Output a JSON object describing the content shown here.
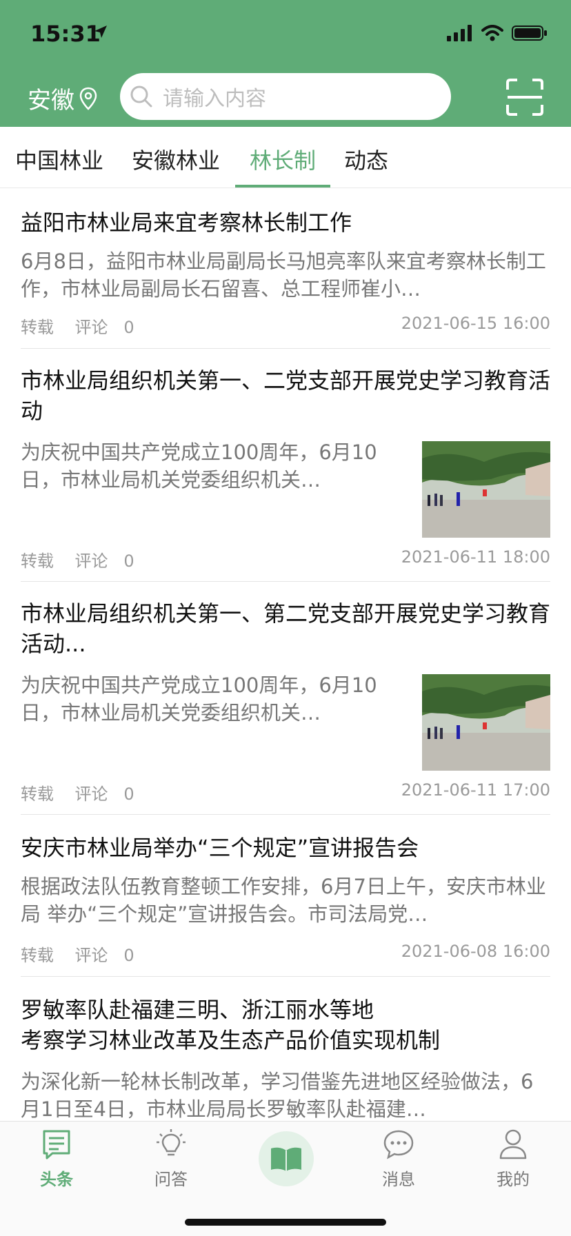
{
  "status_bar": {
    "time": "15:31"
  },
  "header": {
    "location": "安徽",
    "search_placeholder": "请输入内容"
  },
  "tabs": [
    {
      "label": "中国林业",
      "active": false
    },
    {
      "label": "安徽林业",
      "active": false
    },
    {
      "label": "林长制",
      "active": true
    },
    {
      "label": "动态",
      "active": false
    }
  ],
  "articles": [
    {
      "title": "益阳市林业局来宜考察林长制工作",
      "summary": "6月8日，益阳市林业局副局长马旭亮率队来宜考察林长制工作，市林业局副局长石留喜、总工程师崔小…",
      "source": "转载",
      "comment_label": "评论",
      "comments": "0",
      "time": "2021-06-15 16:00",
      "has_image": false
    },
    {
      "title": "市林业局组织机关第一、二党支部开展党史学习教育活动",
      "summary": "为庆祝中国共产党成立100周年，6月10日，市林业局机关党委组织机关…",
      "source": "转载",
      "comment_label": "评论",
      "comments": "0",
      "time": "2021-06-11 18:00",
      "has_image": true
    },
    {
      "title": "市林业局组织机关第一、第二党支部开展党史学习教育活动...",
      "summary": "为庆祝中国共产党成立100周年，6月10日，市林业局机关党委组织机关…",
      "source": "转载",
      "comment_label": "评论",
      "comments": "0",
      "time": "2021-06-11 17:00",
      "has_image": true
    },
    {
      "title": "安庆市林业局举办“三个规定”宣讲报告会",
      "summary": "根据政法队伍教育整顿工作安排，6月7日上午，安庆市林业局 举办“三个规定”宣讲报告会。市司法局党…",
      "source": "转载",
      "comment_label": "评论",
      "comments": "0",
      "time": "2021-06-08 16:00",
      "has_image": false
    },
    {
      "title": "罗敏率队赴福建三明、浙江丽水等地\n考察学习林业改革及生态产品价值实现机制",
      "summary": "为深化新一轮林长制改革，学习借鉴先进地区经验做法，6月1日至4日，市林业局局长罗敏率队赴福建…",
      "has_image": false
    }
  ],
  "bottom_nav": [
    {
      "label": "头条",
      "icon": "news-icon",
      "active": true
    },
    {
      "label": "问答",
      "icon": "lightbulb-icon",
      "active": false
    },
    {
      "label": "",
      "icon": "book-icon",
      "active": false
    },
    {
      "label": "消息",
      "icon": "chat-icon",
      "active": false
    },
    {
      "label": "我的",
      "icon": "user-icon",
      "active": false
    }
  ],
  "colors": {
    "brand_green": "#5fac77",
    "text_dark": "#111111",
    "text_gray": "#777777"
  }
}
